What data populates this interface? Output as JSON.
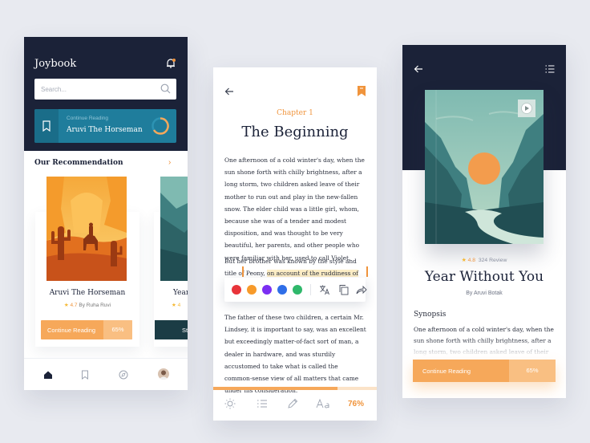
{
  "colors": {
    "navy": "#1b2238",
    "teal": "#1f7d9c",
    "orange": "#f0943c",
    "orange_light": "#f6a85a",
    "highlight": "#fdeec6",
    "palette": [
      "#e8343a",
      "#f79a2a",
      "#7b2ff2",
      "#2f6ee8",
      "#2fb86b"
    ]
  },
  "home": {
    "app_title": "Joybook",
    "search": {
      "placeholder": "Search..."
    },
    "continue": {
      "label": "Continue Reading",
      "book": "Aruvi The Horseman"
    },
    "recommendation_heading": "Our Recommendation",
    "books": [
      {
        "title": "Aruvi The Horseman",
        "rating": "4.7",
        "author": "By Ruha Ruvi",
        "button": "Continue Reading",
        "progress": "65%"
      },
      {
        "title": "Year",
        "rating": "4",
        "button": "St"
      }
    ],
    "nav": [
      "home-icon",
      "bookmark-icon",
      "compass-icon",
      "profile-avatar"
    ]
  },
  "reader": {
    "chapter": "Chapter 1",
    "title": "The Beginning",
    "paragraph1": "One afternoon of a cold winter's day, when the sun shone forth with chilly brightness, after a long storm, two children asked leave of their mother to run out and play in the new-fallen snow. The elder child was a little girl, whom, because she was of a tender and modest disposition, and was thought to be very beautiful, her parents, and other people who were familiar with her, used to call Violet.",
    "paragraph2_before": "But her brother was known by the style and title of Peony, ",
    "paragraph2_highlight": "on account of the ruddiness of his broad and",
    "paragraph3": "The father of these two children, a certain Mr. Lindsey, it is important to say, was an excellent but exceedingly matter-of-fact sort of man, a dealer in hardware, and was sturdily accustomed to take what is called the common-sense view of all matters that came under his consideration.",
    "progress": "76%",
    "progress_value": 0.76
  },
  "detail": {
    "rating": "4.8",
    "reviews": "324 Review",
    "title": "Year Without You",
    "author": "By Aruvi Botak",
    "synopsis_heading": "Synopsis",
    "synopsis": "One afternoon of a cold winter's day, when the sun shone forth with chilly brightness, after a long storm, two children asked leave of their mother",
    "button": "Continue Reading",
    "progress": "65%"
  }
}
